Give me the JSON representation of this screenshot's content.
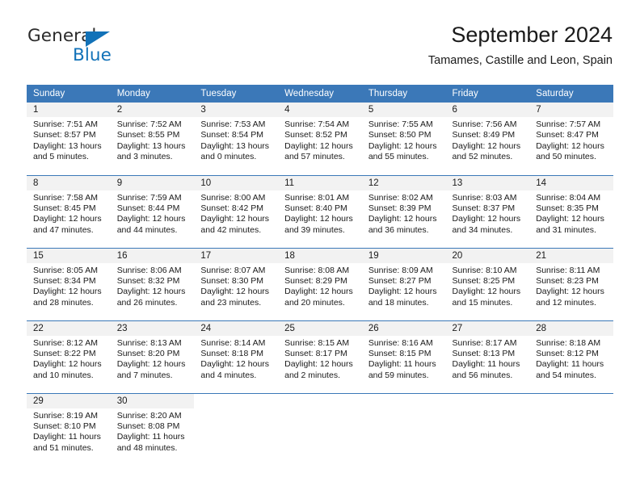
{
  "brand": {
    "name_top": "General",
    "name_bottom": "Blue",
    "accent_color": "#1272b8"
  },
  "header": {
    "month_title": "September 2024",
    "location": "Tamames, Castille and Leon, Spain"
  },
  "theme": {
    "header_row_bg": "#3b78b8",
    "daynum_band_bg": "#f2f2f2",
    "text_color": "#1a1a1a",
    "grid_line": "#3b78b8"
  },
  "weekday_headers": [
    "Sunday",
    "Monday",
    "Tuesday",
    "Wednesday",
    "Thursday",
    "Friday",
    "Saturday"
  ],
  "labels": {
    "sunrise_prefix": "Sunrise:",
    "sunset_prefix": "Sunset:",
    "daylight_prefix": "Daylight:"
  },
  "weeks": [
    [
      {
        "day": "1",
        "sunrise": "Sunrise: 7:51 AM",
        "sunset": "Sunset: 8:57 PM",
        "daylight_1": "Daylight: 13 hours",
        "daylight_2": "and 5 minutes."
      },
      {
        "day": "2",
        "sunrise": "Sunrise: 7:52 AM",
        "sunset": "Sunset: 8:55 PM",
        "daylight_1": "Daylight: 13 hours",
        "daylight_2": "and 3 minutes."
      },
      {
        "day": "3",
        "sunrise": "Sunrise: 7:53 AM",
        "sunset": "Sunset: 8:54 PM",
        "daylight_1": "Daylight: 13 hours",
        "daylight_2": "and 0 minutes."
      },
      {
        "day": "4",
        "sunrise": "Sunrise: 7:54 AM",
        "sunset": "Sunset: 8:52 PM",
        "daylight_1": "Daylight: 12 hours",
        "daylight_2": "and 57 minutes."
      },
      {
        "day": "5",
        "sunrise": "Sunrise: 7:55 AM",
        "sunset": "Sunset: 8:50 PM",
        "daylight_1": "Daylight: 12 hours",
        "daylight_2": "and 55 minutes."
      },
      {
        "day": "6",
        "sunrise": "Sunrise: 7:56 AM",
        "sunset": "Sunset: 8:49 PM",
        "daylight_1": "Daylight: 12 hours",
        "daylight_2": "and 52 minutes."
      },
      {
        "day": "7",
        "sunrise": "Sunrise: 7:57 AM",
        "sunset": "Sunset: 8:47 PM",
        "daylight_1": "Daylight: 12 hours",
        "daylight_2": "and 50 minutes."
      }
    ],
    [
      {
        "day": "8",
        "sunrise": "Sunrise: 7:58 AM",
        "sunset": "Sunset: 8:45 PM",
        "daylight_1": "Daylight: 12 hours",
        "daylight_2": "and 47 minutes."
      },
      {
        "day": "9",
        "sunrise": "Sunrise: 7:59 AM",
        "sunset": "Sunset: 8:44 PM",
        "daylight_1": "Daylight: 12 hours",
        "daylight_2": "and 44 minutes."
      },
      {
        "day": "10",
        "sunrise": "Sunrise: 8:00 AM",
        "sunset": "Sunset: 8:42 PM",
        "daylight_1": "Daylight: 12 hours",
        "daylight_2": "and 42 minutes."
      },
      {
        "day": "11",
        "sunrise": "Sunrise: 8:01 AM",
        "sunset": "Sunset: 8:40 PM",
        "daylight_1": "Daylight: 12 hours",
        "daylight_2": "and 39 minutes."
      },
      {
        "day": "12",
        "sunrise": "Sunrise: 8:02 AM",
        "sunset": "Sunset: 8:39 PM",
        "daylight_1": "Daylight: 12 hours",
        "daylight_2": "and 36 minutes."
      },
      {
        "day": "13",
        "sunrise": "Sunrise: 8:03 AM",
        "sunset": "Sunset: 8:37 PM",
        "daylight_1": "Daylight: 12 hours",
        "daylight_2": "and 34 minutes."
      },
      {
        "day": "14",
        "sunrise": "Sunrise: 8:04 AM",
        "sunset": "Sunset: 8:35 PM",
        "daylight_1": "Daylight: 12 hours",
        "daylight_2": "and 31 minutes."
      }
    ],
    [
      {
        "day": "15",
        "sunrise": "Sunrise: 8:05 AM",
        "sunset": "Sunset: 8:34 PM",
        "daylight_1": "Daylight: 12 hours",
        "daylight_2": "and 28 minutes."
      },
      {
        "day": "16",
        "sunrise": "Sunrise: 8:06 AM",
        "sunset": "Sunset: 8:32 PM",
        "daylight_1": "Daylight: 12 hours",
        "daylight_2": "and 26 minutes."
      },
      {
        "day": "17",
        "sunrise": "Sunrise: 8:07 AM",
        "sunset": "Sunset: 8:30 PM",
        "daylight_1": "Daylight: 12 hours",
        "daylight_2": "and 23 minutes."
      },
      {
        "day": "18",
        "sunrise": "Sunrise: 8:08 AM",
        "sunset": "Sunset: 8:29 PM",
        "daylight_1": "Daylight: 12 hours",
        "daylight_2": "and 20 minutes."
      },
      {
        "day": "19",
        "sunrise": "Sunrise: 8:09 AM",
        "sunset": "Sunset: 8:27 PM",
        "daylight_1": "Daylight: 12 hours",
        "daylight_2": "and 18 minutes."
      },
      {
        "day": "20",
        "sunrise": "Sunrise: 8:10 AM",
        "sunset": "Sunset: 8:25 PM",
        "daylight_1": "Daylight: 12 hours",
        "daylight_2": "and 15 minutes."
      },
      {
        "day": "21",
        "sunrise": "Sunrise: 8:11 AM",
        "sunset": "Sunset: 8:23 PM",
        "daylight_1": "Daylight: 12 hours",
        "daylight_2": "and 12 minutes."
      }
    ],
    [
      {
        "day": "22",
        "sunrise": "Sunrise: 8:12 AM",
        "sunset": "Sunset: 8:22 PM",
        "daylight_1": "Daylight: 12 hours",
        "daylight_2": "and 10 minutes."
      },
      {
        "day": "23",
        "sunrise": "Sunrise: 8:13 AM",
        "sunset": "Sunset: 8:20 PM",
        "daylight_1": "Daylight: 12 hours",
        "daylight_2": "and 7 minutes."
      },
      {
        "day": "24",
        "sunrise": "Sunrise: 8:14 AM",
        "sunset": "Sunset: 8:18 PM",
        "daylight_1": "Daylight: 12 hours",
        "daylight_2": "and 4 minutes."
      },
      {
        "day": "25",
        "sunrise": "Sunrise: 8:15 AM",
        "sunset": "Sunset: 8:17 PM",
        "daylight_1": "Daylight: 12 hours",
        "daylight_2": "and 2 minutes."
      },
      {
        "day": "26",
        "sunrise": "Sunrise: 8:16 AM",
        "sunset": "Sunset: 8:15 PM",
        "daylight_1": "Daylight: 11 hours",
        "daylight_2": "and 59 minutes."
      },
      {
        "day": "27",
        "sunrise": "Sunrise: 8:17 AM",
        "sunset": "Sunset: 8:13 PM",
        "daylight_1": "Daylight: 11 hours",
        "daylight_2": "and 56 minutes."
      },
      {
        "day": "28",
        "sunrise": "Sunrise: 8:18 AM",
        "sunset": "Sunset: 8:12 PM",
        "daylight_1": "Daylight: 11 hours",
        "daylight_2": "and 54 minutes."
      }
    ],
    [
      {
        "day": "29",
        "sunrise": "Sunrise: 8:19 AM",
        "sunset": "Sunset: 8:10 PM",
        "daylight_1": "Daylight: 11 hours",
        "daylight_2": "and 51 minutes."
      },
      {
        "day": "30",
        "sunrise": "Sunrise: 8:20 AM",
        "sunset": "Sunset: 8:08 PM",
        "daylight_1": "Daylight: 11 hours",
        "daylight_2": "and 48 minutes."
      },
      {
        "day": "",
        "sunrise": "",
        "sunset": "",
        "daylight_1": "",
        "daylight_2": ""
      },
      {
        "day": "",
        "sunrise": "",
        "sunset": "",
        "daylight_1": "",
        "daylight_2": ""
      },
      {
        "day": "",
        "sunrise": "",
        "sunset": "",
        "daylight_1": "",
        "daylight_2": ""
      },
      {
        "day": "",
        "sunrise": "",
        "sunset": "",
        "daylight_1": "",
        "daylight_2": ""
      },
      {
        "day": "",
        "sunrise": "",
        "sunset": "",
        "daylight_1": "",
        "daylight_2": ""
      }
    ]
  ]
}
